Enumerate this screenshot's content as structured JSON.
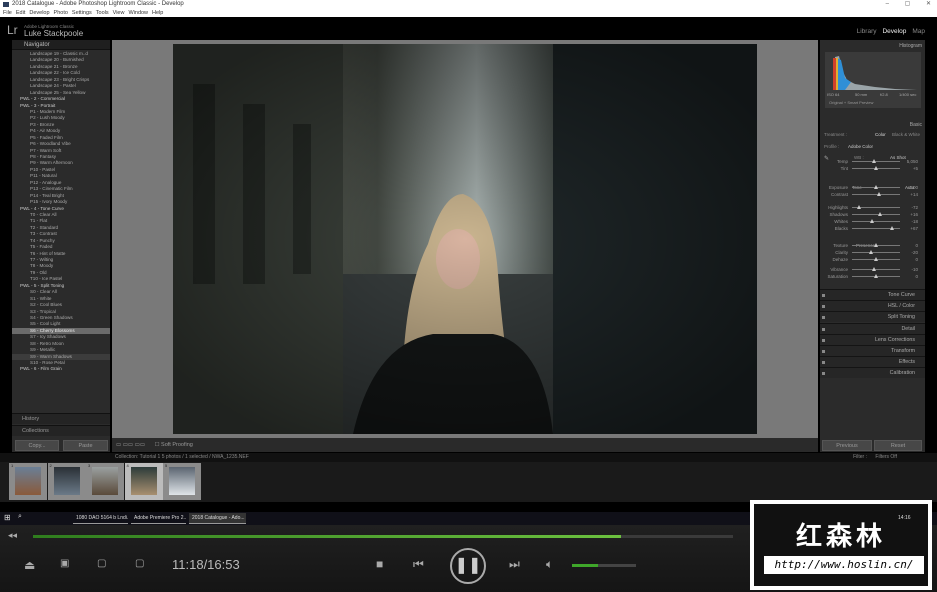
{
  "window": {
    "title": "2018 Catalogue - Adobe Photoshop Lightroom Classic - Develop",
    "controls": [
      "–",
      "▢",
      "✕"
    ]
  },
  "menu": [
    "File",
    "Edit",
    "Develop",
    "Photo",
    "Settings",
    "Tools",
    "View",
    "Window",
    "Help"
  ],
  "header": {
    "logo": "Lr",
    "product": "Adobe Lightroom Classic",
    "user": "Luke Stackpoole",
    "modules": [
      "Library",
      "Develop",
      "Map"
    ]
  },
  "left": {
    "navigator": "Navigator",
    "presets": [
      {
        "l": "Landscape 19 - Classic m..d"
      },
      {
        "l": "Landscape 20 - Burnished"
      },
      {
        "l": "Landscape 21 - Bronze"
      },
      {
        "l": "Landscape 22 - Ice Cold"
      },
      {
        "l": "Landscape 23 - Bright Crisps"
      },
      {
        "l": "Landscape 24 - Pastel"
      },
      {
        "l": "Landscape 25 - Sea Yellow"
      },
      {
        "l": "PWL - 2 - Commercial",
        "g": 1
      },
      {
        "l": "PWL - 3 - Portrait",
        "g": 1
      },
      {
        "l": "P1 - Modern Film"
      },
      {
        "l": "P2 - Lush Moody"
      },
      {
        "l": "P3 - Bronze"
      },
      {
        "l": "P4 - Air Moody"
      },
      {
        "l": "P5 - Faded Film"
      },
      {
        "l": "P6 - Woodland Vibe"
      },
      {
        "l": "P7 - Warm Soft"
      },
      {
        "l": "P8 - Fantasy"
      },
      {
        "l": "P9 - Warm Afternoon"
      },
      {
        "l": "P10 - Pastel"
      },
      {
        "l": "P11 - Natural"
      },
      {
        "l": "P12 - Analogue"
      },
      {
        "l": "P13 - Cinematic Film"
      },
      {
        "l": "P14 - Teal Bright"
      },
      {
        "l": "P15 - Ivory Moody"
      },
      {
        "l": "PWL - 4 - Tone Curve",
        "g": 1
      },
      {
        "l": "T0 - Clear All"
      },
      {
        "l": "T1 - Flat"
      },
      {
        "l": "T2 - Standard"
      },
      {
        "l": "T3 - Contrast"
      },
      {
        "l": "T4 - Punchy"
      },
      {
        "l": "T5 - Faded"
      },
      {
        "l": "T6 - Hint of Matte"
      },
      {
        "l": "T7 - Wilting"
      },
      {
        "l": "T8 - Moody"
      },
      {
        "l": "T9 - Old"
      },
      {
        "l": "T10 - Ice Pastel"
      },
      {
        "l": "PWL - 5 - Split Toning",
        "g": 1
      },
      {
        "l": "S0 - Clear All"
      },
      {
        "l": "S1 - White"
      },
      {
        "l": "S2 - Cool Blues"
      },
      {
        "l": "S3 - Tropical"
      },
      {
        "l": "S4 - Green Shadows"
      },
      {
        "l": "S5 - Cool Light"
      },
      {
        "l": "S6 - Cherry Blossoms",
        "s": 1
      },
      {
        "l": "S7 - Icy Shadows"
      },
      {
        "l": "S8 - Retro Moon"
      },
      {
        "l": "S9 - Metallic"
      },
      {
        "l": "S9 - Warm Shadows",
        "h": 1
      },
      {
        "l": "S10 - Rose Petal"
      },
      {
        "l": "PWL - 6 - Film Grain",
        "g": 1
      }
    ],
    "history": "History",
    "collections": "Collections",
    "copy": "Copy...",
    "paste": "Paste"
  },
  "toolbar": {
    "soft_proofing": "Soft Proofing"
  },
  "right": {
    "histogram": "Histogram",
    "hist_info": [
      "ISO 64",
      "50 mm",
      "f/2.8",
      "1/400 sec"
    ],
    "original": "Original + Smart Preview",
    "basic": "Basic",
    "treatment": "Treatment :",
    "color": "Color",
    "bw": "Black & White",
    "profile": "Profile :",
    "profile_val": "Adobe Color",
    "wb": "WB :",
    "wb_val": "As Shot",
    "tone": "Tone",
    "auto": "Auto",
    "presence": "Presence",
    "sliders": [
      {
        "n": "Temp",
        "v": "5,050",
        "p": 0.45
      },
      {
        "n": "Tint",
        "v": "+5",
        "p": 0.5
      },
      {
        "n": "Exposure",
        "v": "0.00",
        "p": 0.5
      },
      {
        "n": "Contrast",
        "v": "+14",
        "p": 0.57
      },
      {
        "n": "Highlights",
        "v": "-72",
        "p": 0.14
      },
      {
        "n": "Shadows",
        "v": "+16",
        "p": 0.58
      },
      {
        "n": "Whites",
        "v": "-18",
        "p": 0.41
      },
      {
        "n": "Blacks",
        "v": "+67",
        "p": 0.83
      },
      {
        "n": "Texture",
        "v": "0",
        "p": 0.5
      },
      {
        "n": "Clarity",
        "v": "-20",
        "p": 0.4
      },
      {
        "n": "Dehaze",
        "v": "0",
        "p": 0.5
      },
      {
        "n": "Vibrance",
        "v": "-10",
        "p": 0.45
      },
      {
        "n": "Saturation",
        "v": "0",
        "p": 0.5
      }
    ],
    "sections": [
      "Tone Curve",
      "HSL / Color",
      "Split Toning",
      "Detail",
      "Lens Corrections",
      "Transform",
      "Effects",
      "Calibration"
    ],
    "previous": "Previous",
    "reset": "Reset"
  },
  "filmstrip": {
    "info": "Collection: Tutorial 1    5 photos / 1 selected / NWA_1235.NEF",
    "filter": "Filter :",
    "filter_val": "Filters Off",
    "numbers": [
      "1",
      "2",
      "3",
      "4",
      "5"
    ],
    "selected": 4
  },
  "taskbar": {
    "items": [
      "1080 DAO 5164 b Lndi...",
      "Adobe Premiere Pro 2...",
      "2018 Catalogue - Ado..."
    ],
    "clock": "14:16"
  },
  "player": {
    "time": "11:18/16:53",
    "progress": 0.84,
    "volume": 0.4
  },
  "watermark": {
    "cn": "红森林",
    "url": "http://www.hoslin.cn/"
  }
}
